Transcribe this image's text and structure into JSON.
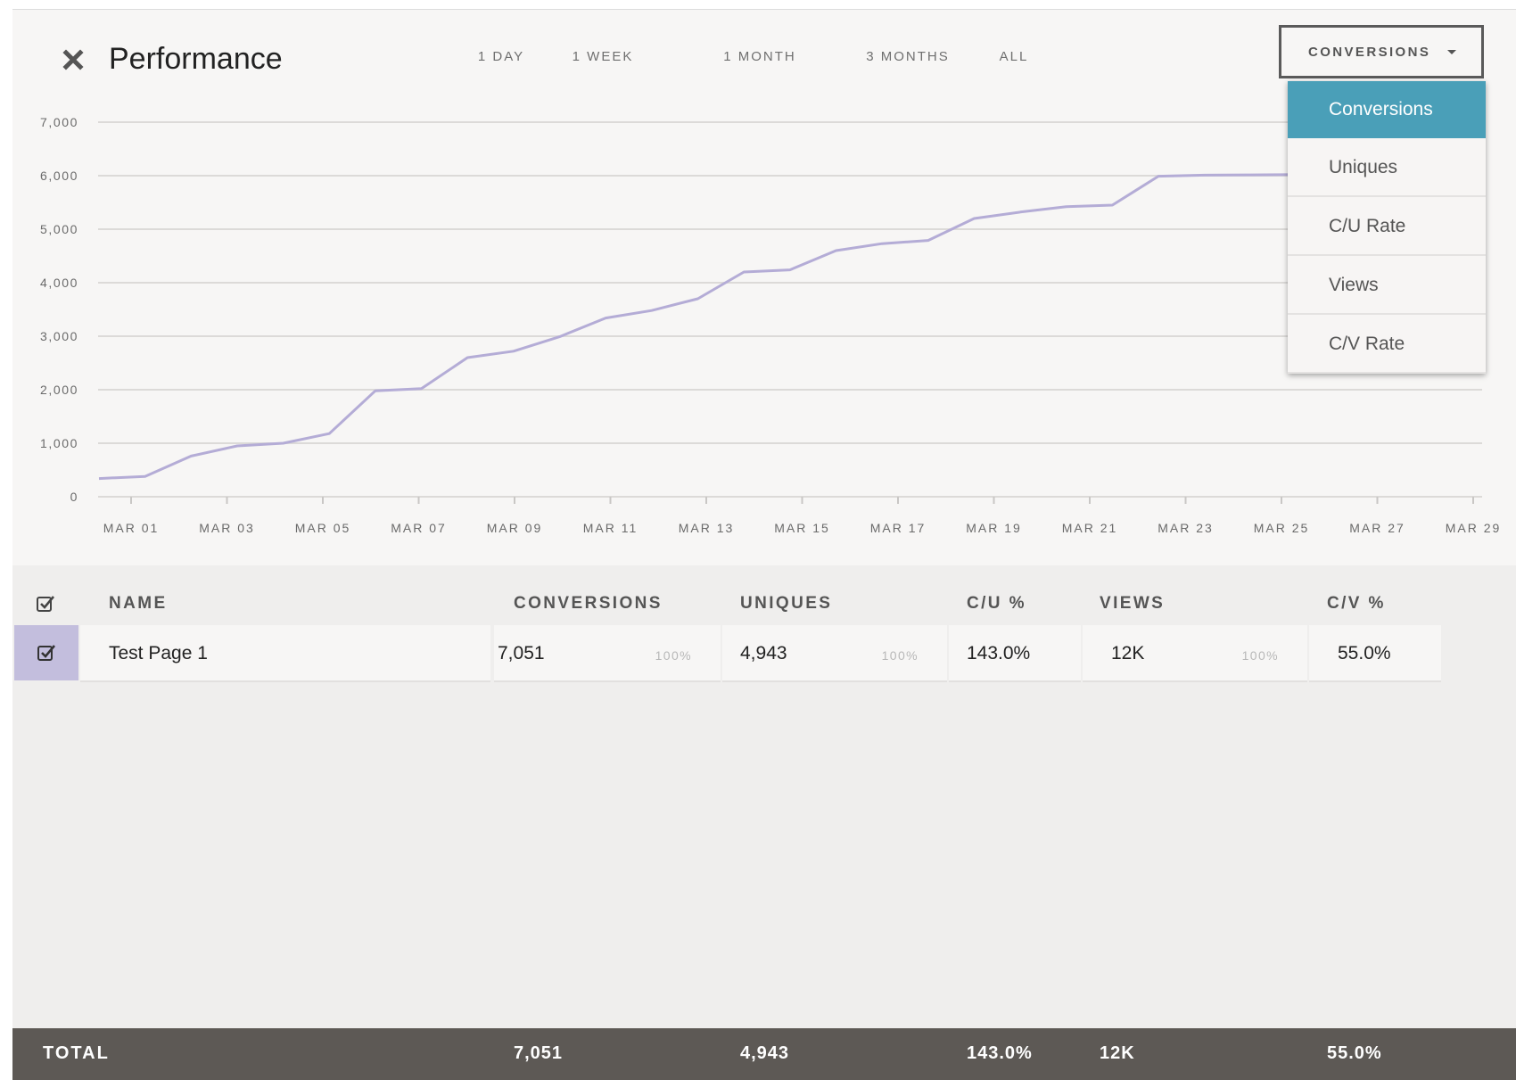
{
  "header": {
    "title": "Performance",
    "ranges": [
      {
        "label": "1 DAY",
        "active": false
      },
      {
        "label": "1 WEEK",
        "active": false
      },
      {
        "label": "1 MONTH",
        "active": true
      },
      {
        "label": "3 MONTHS",
        "active": false
      },
      {
        "label": "ALL",
        "active": false
      }
    ],
    "metric_select": {
      "value": "CONVERSIONS",
      "options": [
        "Conversions",
        "Uniques",
        "C/U Rate",
        "Views",
        "C/V Rate"
      ],
      "selected_index": 0
    }
  },
  "chart_data": {
    "type": "line",
    "ylim": [
      0,
      7000
    ],
    "yticks": [
      "0",
      "1,000",
      "2,000",
      "3,000",
      "4,000",
      "5,000",
      "6,000",
      "7,000"
    ],
    "yvalues": [
      0,
      1000,
      2000,
      3000,
      4000,
      5000,
      6000,
      7000
    ],
    "xtick_labels": [
      "MAR 01",
      "MAR 03",
      "MAR 05",
      "MAR 07",
      "MAR 09",
      "MAR 11",
      "MAR 13",
      "MAR 15",
      "MAR 17",
      "MAR 19",
      "MAR 21",
      "MAR 23",
      "MAR 25",
      "MAR 27",
      "MAR 29"
    ],
    "grid": true,
    "line_color": "#b4acd6",
    "series": [
      {
        "values": [
          340,
          380,
          760,
          950,
          1000,
          1180,
          1980,
          2020,
          2600,
          2720,
          2990,
          3340,
          3480,
          3700,
          4200,
          4240,
          4600,
          4730,
          4790,
          5200,
          5320,
          5420,
          5450,
          5990,
          6010,
          6015,
          6020
        ]
      }
    ]
  },
  "table": {
    "columns": [
      "NAME",
      "CONVERSIONS",
      "UNIQUES",
      "C/U %",
      "VIEWS",
      "C/V %"
    ],
    "row": {
      "checked": true,
      "name": "Test Page 1",
      "conversions": "7,051",
      "conversions_pct": "100%",
      "uniques": "4,943",
      "uniques_pct": "100%",
      "cu_rate": "143.0%",
      "views": "12K",
      "views_pct": "100%",
      "cv_rate": "55.0%"
    },
    "total": {
      "label": "TOTAL",
      "conversions": "7,051",
      "uniques": "4,943",
      "cu_rate": "143.0%",
      "views": "12K",
      "cv_rate": "55.0%"
    }
  },
  "colors": {
    "accent": "#4a9fb8",
    "check_cell": "#c3bedd",
    "total_bar": "#5d5955"
  }
}
